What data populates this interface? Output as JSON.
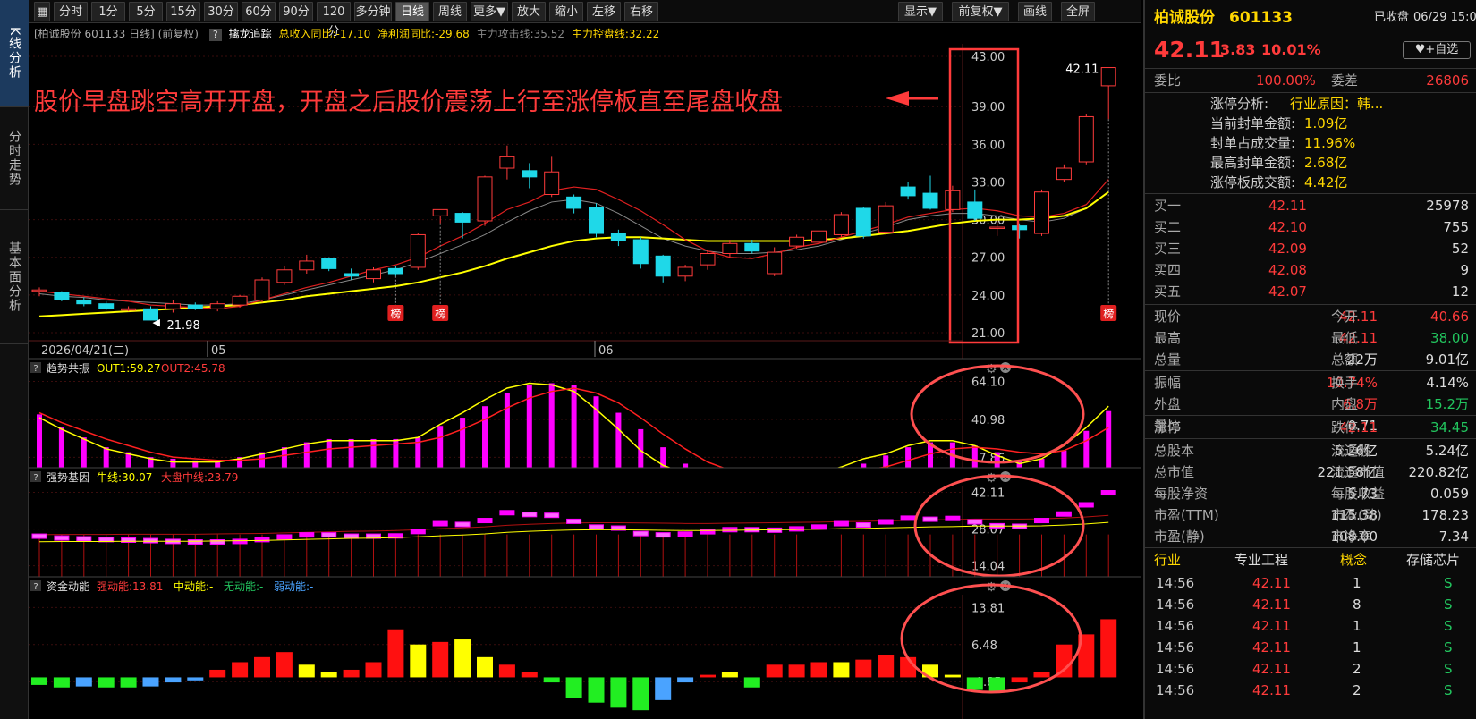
{
  "left_nav": [
    "K线分析",
    "分时走势",
    "基本面分析"
  ],
  "toolbar": {
    "periods": [
      "分时",
      "1分",
      "5分",
      "15分",
      "30分",
      "60分",
      "90分",
      "120分",
      "多分钟",
      "日线",
      "周线",
      "更多▼",
      "放大",
      "缩小",
      "左移",
      "右移"
    ],
    "selected": "日线",
    "right": [
      "显示▼",
      "前复权▼",
      "画线",
      "全屏"
    ]
  },
  "info_bar": {
    "stock": "[柏诚股份 601133 日线] (前复权)",
    "help": "?",
    "indicator": "擒龙追踪",
    "revenue": "总收入同比:-17.10",
    "profit": "净利润同比:-29.68",
    "attack": "主力攻击线:35.52",
    "control": "主力控盘线:32.22"
  },
  "annotation": "股价早盘跳空高开开盘，开盘之后股价震荡上行至涨停板直至尾盘收盘",
  "main_chart": {
    "price_axis": [
      "43.00",
      "39.00",
      "36.00",
      "33.00",
      "30.00",
      "27.00",
      "24.00",
      "21.00"
    ],
    "date_labels": [
      "2026/04/21(二)",
      "05",
      "06"
    ],
    "high_label": "42.11",
    "low_label": "21.98",
    "badge": "榜"
  },
  "chart_data": [
    {
      "type": "candlestick",
      "ylim": [
        20.5,
        44
      ],
      "candles": [
        [
          24.3,
          24.4,
          24.6,
          23.9
        ],
        [
          24.2,
          23.6,
          24.3,
          23.5
        ],
        [
          23.6,
          23.3,
          23.8,
          23.1
        ],
        [
          23.3,
          22.9,
          23.5,
          22.8
        ],
        [
          22.9,
          22.9,
          23.1,
          22.7
        ],
        [
          22.9,
          22.0,
          23.1,
          21.98
        ],
        [
          22.9,
          23.3,
          23.6,
          22.6
        ],
        [
          23.2,
          22.9,
          23.4,
          22.8
        ],
        [
          22.9,
          23.3,
          23.5,
          22.7
        ],
        [
          23.2,
          23.9,
          24.0,
          23.0
        ],
        [
          23.6,
          25.2,
          25.4,
          23.4
        ],
        [
          25.0,
          26.0,
          26.3,
          24.8
        ],
        [
          26.0,
          26.7,
          27.2,
          25.7
        ],
        [
          26.9,
          26.1,
          27.0,
          25.9
        ],
        [
          25.7,
          25.5,
          26.1,
          25.2
        ],
        [
          25.3,
          26.0,
          26.2,
          25.0
        ],
        [
          26.1,
          25.7,
          26.3,
          25.5
        ],
        [
          26.2,
          28.8,
          28.9,
          26.0
        ],
        [
          30.3,
          30.8,
          30.8,
          29.7
        ],
        [
          30.5,
          29.8,
          30.6,
          28.5
        ],
        [
          29.9,
          33.4,
          33.5,
          29.5
        ],
        [
          34.1,
          35.0,
          35.9,
          33.2
        ],
        [
          33.9,
          33.4,
          34.5,
          32.5
        ],
        [
          32.0,
          33.8,
          35.0,
          31.8
        ],
        [
          31.8,
          30.9,
          32.0,
          30.5
        ],
        [
          31.0,
          28.9,
          31.3,
          28.6
        ],
        [
          28.9,
          28.3,
          29.2,
          27.9
        ],
        [
          28.4,
          26.5,
          28.6,
          26.1
        ],
        [
          27.1,
          25.5,
          27.2,
          25.0
        ],
        [
          25.5,
          26.2,
          26.4,
          25.1
        ],
        [
          26.4,
          27.3,
          27.6,
          26.0
        ],
        [
          27.3,
          28.1,
          28.4,
          27.0
        ],
        [
          28.1,
          27.5,
          28.4,
          27.3
        ],
        [
          25.7,
          27.4,
          27.8,
          25.5
        ],
        [
          27.9,
          28.6,
          28.8,
          27.7
        ],
        [
          28.2,
          29.1,
          29.4,
          27.9
        ],
        [
          28.8,
          30.4,
          30.6,
          28.6
        ],
        [
          30.9,
          28.7,
          31.0,
          28.5
        ],
        [
          29.0,
          31.1,
          31.4,
          28.8
        ],
        [
          32.6,
          31.9,
          33.0,
          31.6
        ],
        [
          32.1,
          30.9,
          33.5,
          30.8
        ],
        [
          30.8,
          32.3,
          32.7,
          30.6
        ],
        [
          31.4,
          30.1,
          32.4,
          29.9
        ],
        [
          29.4,
          29.4,
          29.9,
          28.7
        ],
        [
          29.5,
          29.2,
          29.7,
          28.5
        ],
        [
          28.9,
          32.2,
          32.4,
          28.7
        ],
        [
          33.2,
          34.1,
          34.4,
          33.0
        ],
        [
          34.6,
          38.2,
          38.4,
          34.4
        ],
        [
          40.66,
          42.11,
          42.11,
          38.0
        ]
      ],
      "ma5": [
        24.3,
        24.1,
        23.9,
        23.7,
        23.5,
        23.2,
        23.1,
        23.0,
        22.9,
        23.1,
        23.6,
        24.1,
        24.6,
        25.0,
        25.5,
        26.0,
        26.4,
        27.0,
        27.9,
        28.7,
        29.7,
        30.8,
        31.4,
        32.3,
        32.6,
        32.4,
        31.6,
        30.7,
        29.6,
        28.4,
        27.5,
        27.0,
        26.9,
        27.3,
        27.8,
        28.1,
        28.6,
        29.1,
        29.6,
        30.2,
        30.5,
        30.8,
        30.9,
        30.7,
        30.3,
        30.2,
        30.5,
        31.2,
        33.2
      ],
      "ma_yellow": [
        22.3,
        22.4,
        22.5,
        22.6,
        22.7,
        22.8,
        22.9,
        23.0,
        23.1,
        23.2,
        23.4,
        23.6,
        23.9,
        24.1,
        24.3,
        24.5,
        24.7,
        25.0,
        25.4,
        25.8,
        26.3,
        26.9,
        27.4,
        27.9,
        28.3,
        28.5,
        28.6,
        28.6,
        28.5,
        28.4,
        28.3,
        28.3,
        28.3,
        28.3,
        28.3,
        28.4,
        28.5,
        28.7,
        28.9,
        29.1,
        29.4,
        29.7,
        29.9,
        30.0,
        30.0,
        30.1,
        30.3,
        30.9,
        32.2
      ],
      "ma_gray": [
        24.1,
        23.9,
        23.8,
        23.6,
        23.5,
        23.4,
        23.3,
        23.2,
        23.2,
        23.3,
        23.6,
        24.0,
        24.4,
        24.8,
        25.2,
        25.6,
        26.0,
        26.6,
        27.3,
        28.0,
        28.8,
        29.8,
        30.7,
        31.4,
        31.6,
        31.3,
        30.5,
        29.5,
        28.5,
        27.9,
        27.5,
        27.3,
        27.3,
        27.4,
        27.6,
        27.9,
        28.4,
        28.9,
        29.4,
        30.0,
        30.3,
        30.5,
        30.5,
        30.3,
        30.0,
        29.8,
        30.1,
        30.9,
        32.2
      ]
    },
    {
      "name": "趋势共振",
      "out1": "OUT1:59.27",
      "out2": "OUT2:45.78",
      "axis": [
        "64.10",
        "40.98",
        "17.86"
      ],
      "ylim": [
        5,
        66
      ],
      "bars": [
        44,
        36,
        30,
        24,
        21,
        18,
        17,
        16,
        16,
        18,
        21,
        24,
        27,
        29,
        29,
        29,
        29,
        30,
        37,
        42,
        49,
        57,
        62,
        63,
        62,
        55,
        45,
        35,
        24,
        14,
        9,
        7,
        7,
        7,
        7,
        8,
        11,
        14,
        19,
        24,
        27,
        27,
        25,
        21,
        16,
        17,
        22,
        34,
        46
      ],
      "line1": [
        42,
        35,
        29,
        23,
        20,
        17,
        15,
        15,
        15,
        17,
        20,
        23,
        26,
        28,
        28,
        28,
        28,
        30,
        38,
        45,
        53,
        60,
        63,
        62,
        58,
        47,
        35,
        22,
        13,
        8,
        6,
        6,
        6,
        6,
        6,
        8,
        12,
        17,
        20,
        25,
        28,
        28,
        25,
        19,
        14,
        17,
        25,
        36,
        49
      ],
      "line2": [
        45,
        39,
        34,
        29,
        25,
        21,
        18,
        17,
        16,
        16,
        17,
        19,
        21,
        23,
        24,
        25,
        26,
        27,
        30,
        35,
        41,
        48,
        54,
        58,
        60,
        57,
        51,
        42,
        32,
        23,
        15,
        10,
        8,
        7,
        7,
        7,
        8,
        10,
        12,
        16,
        20,
        23,
        24,
        23,
        21,
        20,
        22,
        28,
        36
      ]
    },
    {
      "name": "强势基因",
      "bull": "牛线:30.07",
      "mid": "大盘中线:23.79",
      "axis": [
        "42.11",
        "28.07",
        "14.04"
      ],
      "ylim": [
        5,
        44
      ],
      "vals": [
        25.5,
        24.8,
        24.5,
        24.2,
        24.0,
        23.8,
        23.5,
        23.3,
        23.3,
        23.5,
        24.2,
        25.2,
        26.0,
        26.0,
        25.5,
        25.5,
        25.6,
        27.3,
        30.3,
        30.0,
        31.5,
        34.5,
        33.8,
        33.5,
        31.2,
        29.0,
        28.6,
        26.5,
        26.0,
        26.3,
        27.2,
        28.0,
        28.0,
        27.8,
        28.3,
        29.0,
        30.3,
        29.8,
        31.0,
        32.4,
        32.0,
        32.3,
        31.0,
        29.5,
        29.3,
        31.5,
        34.0,
        37.5,
        42.11
      ],
      "ma": [
        23.2,
        23.3,
        23.3,
        23.3,
        23.4,
        23.4,
        23.4,
        23.4,
        23.5,
        23.6,
        23.7,
        23.9,
        24.1,
        24.3,
        24.5,
        24.6,
        24.8,
        25.1,
        25.5,
        25.8,
        26.2,
        26.8,
        27.2,
        27.5,
        27.7,
        27.8,
        27.8,
        27.7,
        27.6,
        27.5,
        27.5,
        27.6,
        27.7,
        27.8,
        27.9,
        28.0,
        28.2,
        28.3,
        28.5,
        28.7,
        28.9,
        29.0,
        29.2,
        29.2,
        29.2,
        29.3,
        29.6,
        30.0,
        30.6
      ]
    },
    {
      "name": "资金动能",
      "strong": "强动能:13.81",
      "midtxt": "中动能:-",
      "none": "无动能:-",
      "weak": "弱动能:-",
      "axis": [
        "13.81",
        "6.48",
        "-0.85"
      ],
      "ylim": [
        -7,
        16
      ],
      "vals": [
        -1.5,
        -2.0,
        -1.8,
        -2.0,
        -2.0,
        -1.8,
        -1.0,
        -0.6,
        1.5,
        3.0,
        4.0,
        5.0,
        2.5,
        1.0,
        1.5,
        3.0,
        9.5,
        6.5,
        7.0,
        7.5,
        4.0,
        2.5,
        1.0,
        -1.0,
        -4.0,
        -5.0,
        -6.0,
        -6.5,
        -4.5,
        -1.0,
        0.5,
        1.0,
        -2.0,
        2.5,
        2.5,
        3.0,
        3.0,
        3.5,
        4.5,
        4.0,
        2.5,
        0.5,
        -2.5,
        -3.0,
        -1.0,
        1.0,
        6.5,
        8.5,
        11.5
      ],
      "colors": [
        "green",
        "green",
        "blue",
        "green",
        "green",
        "blue",
        "blue",
        "blue",
        "red",
        "red",
        "red",
        "red",
        "yellow",
        "yellow",
        "red",
        "red",
        "red",
        "yellow",
        "red",
        "yellow",
        "yellow",
        "red",
        "red",
        "green",
        "green",
        "green",
        "green",
        "green",
        "blue",
        "blue",
        "red",
        "yellow",
        "green",
        "red",
        "red",
        "red",
        "yellow",
        "red",
        "red",
        "red",
        "yellow",
        "yellow",
        "green",
        "green",
        "red",
        "red",
        "red",
        "red",
        "red"
      ]
    }
  ],
  "right_panel": {
    "title": "柏诚股份",
    "code": "601133",
    "status": "已收盘",
    "datetime": "06/29 15:00",
    "price": "42.11",
    "change": "3.83",
    "pct": "10.01%",
    "add_fav": "+自选",
    "ratio": {
      "label": "委比",
      "value": "100.00%",
      "label2": "委差",
      "value2": "26806"
    },
    "limit": [
      {
        "label": "涨停分析:",
        "value": "行业原因：韩..."
      },
      {
        "label": "当前封单金额:",
        "value": "1.09亿"
      },
      {
        "label": "封单占成交量:",
        "value": "11.96%"
      },
      {
        "label": "最高封单金额:",
        "value": "2.68亿"
      },
      {
        "label": "涨停板成交额:",
        "value": "4.42亿"
      }
    ],
    "buy": [
      {
        "l": "买一",
        "p": "42.11",
        "v": "25978"
      },
      {
        "l": "买二",
        "p": "42.10",
        "v": "755"
      },
      {
        "l": "买三",
        "p": "42.09",
        "v": "52"
      },
      {
        "l": "买四",
        "p": "42.08",
        "v": "9"
      },
      {
        "l": "买五",
        "p": "42.07",
        "v": "12"
      }
    ],
    "stats1": [
      [
        "现价",
        "42.11",
        "今开",
        "40.66"
      ],
      [
        "最高",
        "42.11",
        "最低",
        "38.00"
      ],
      [
        "总量",
        "22万",
        "总额",
        "9.01亿"
      ]
    ],
    "stats2": [
      [
        "振幅",
        "10.74%",
        "换手",
        "4.14%"
      ],
      [
        "外盘",
        "6.8万",
        "内盘",
        "15.2万"
      ],
      [
        "量比",
        "0.71",
        "",
        ""
      ]
    ],
    "stats3": [
      [
        "涨停",
        "42.11",
        "跌停",
        "34.45"
      ]
    ],
    "stats4": [
      [
        "总股本",
        "5.26亿",
        "流通股",
        "5.24亿"
      ],
      [
        "总市值",
        "221.58亿",
        "流通市值",
        "220.82亿"
      ],
      [
        "每股净资",
        "5.73",
        "每股收益",
        "0.059"
      ],
      [
        "市盈(TTM)",
        "115.38",
        "市盈(动)",
        "178.23"
      ],
      [
        "市盈(静)",
        "108.00",
        "市净率",
        "7.34"
      ]
    ],
    "tags": [
      "行业",
      "专业工程",
      "概念",
      "存储芯片"
    ],
    "ticks": [
      [
        "14:56",
        "42.11",
        "1",
        "S"
      ],
      [
        "14:56",
        "42.11",
        "8",
        "S"
      ],
      [
        "14:56",
        "42.11",
        "1",
        "S"
      ],
      [
        "14:56",
        "42.11",
        "1",
        "S"
      ],
      [
        "14:56",
        "42.11",
        "2",
        "S"
      ],
      [
        "14:56",
        "42.11",
        "2",
        "S"
      ]
    ]
  }
}
